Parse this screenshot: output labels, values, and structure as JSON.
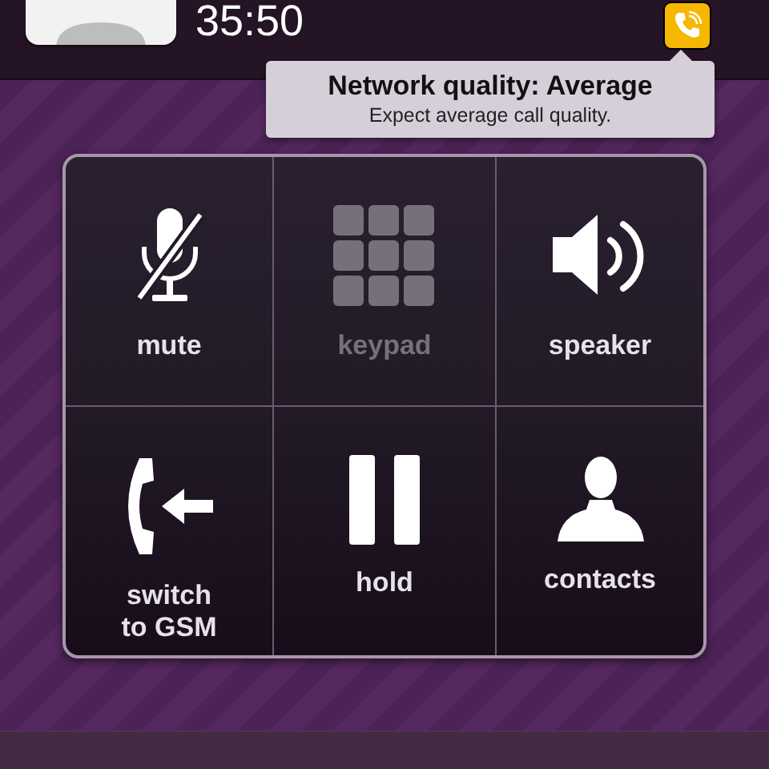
{
  "call": {
    "duration": "35:50"
  },
  "network_tooltip": {
    "title": "Network quality: Average",
    "message": "Expect average call quality."
  },
  "buttons": [
    {
      "label": "mute",
      "kind": "mute",
      "disabled": false
    },
    {
      "label": "keypad",
      "kind": "keypad",
      "disabled": true
    },
    {
      "label": "speaker",
      "kind": "speaker",
      "disabled": false
    },
    {
      "label": "switch\nto GSM",
      "kind": "switch",
      "disabled": false
    },
    {
      "label": "hold",
      "kind": "hold",
      "disabled": false
    },
    {
      "label": "contacts",
      "kind": "contacts",
      "disabled": false
    }
  ]
}
